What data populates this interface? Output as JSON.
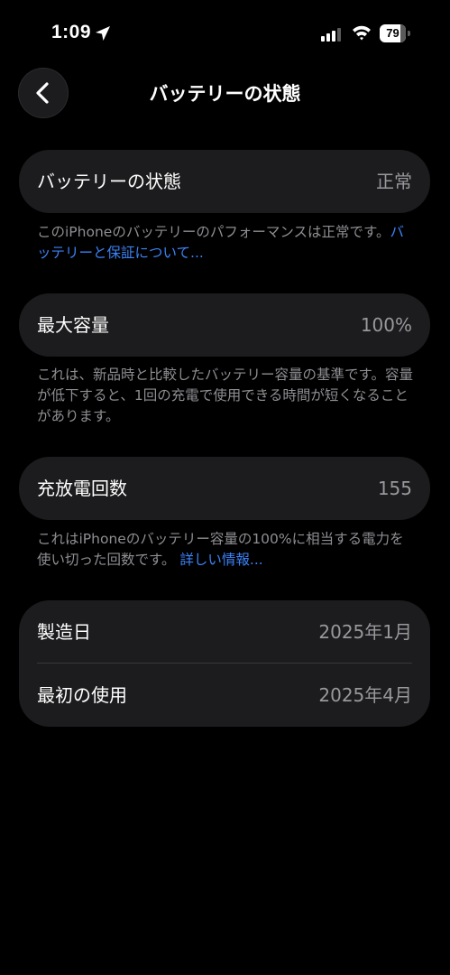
{
  "status_bar": {
    "time": "1:09",
    "battery_percent": 79
  },
  "nav": {
    "title": "バッテリーの状態"
  },
  "battery_health": {
    "label": "バッテリーの状態",
    "value": "正常",
    "footnote": "このiPhoneのバッテリーのパフォーマンスは正常です。",
    "link": "バッテリーと保証について..."
  },
  "max_capacity": {
    "label": "最大容量",
    "value": "100%",
    "footnote": "これは、新品時と比較したバッテリー容量の基準です。容量が低下すると、1回の充電で使用できる時間が短くなることがあります。"
  },
  "cycle_count": {
    "label": "充放電回数",
    "value": "155",
    "footnote": "これはiPhoneのバッテリー容量の100%に相当する電力を使い切った回数です。",
    "link": "詳しい情報..."
  },
  "dates": {
    "manufacture_label": "製造日",
    "manufacture_value": "2025年1月",
    "first_use_label": "最初の使用",
    "first_use_value": "2025年4月"
  },
  "colors": {
    "background": "#000000",
    "card": "#1c1c1e",
    "secondary_text": "#8e8e93",
    "link": "#3b82f6"
  }
}
